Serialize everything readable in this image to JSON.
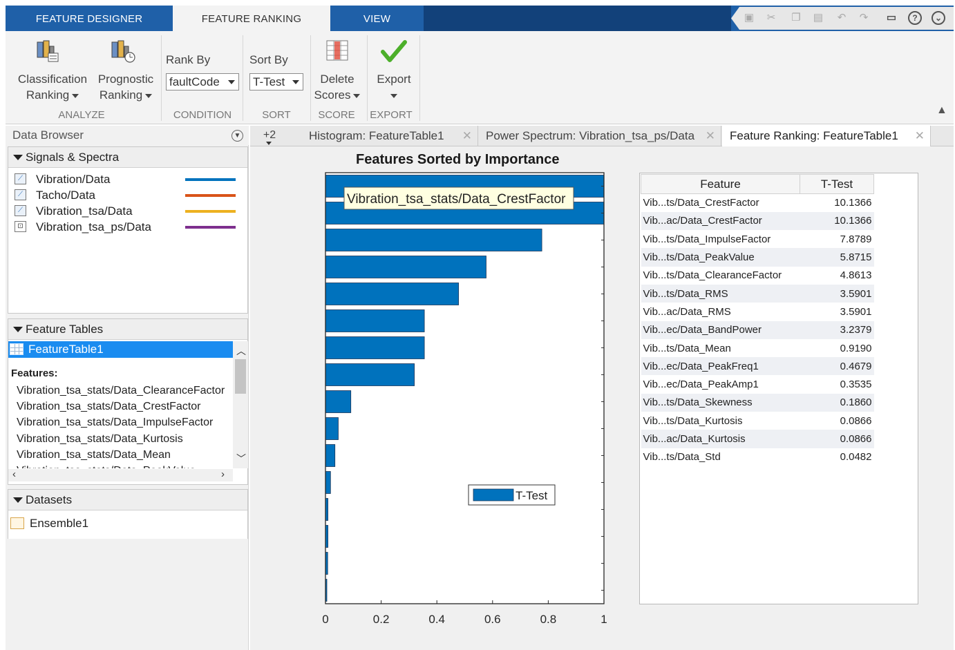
{
  "toolstrip": {
    "tabs": [
      "FEATURE DESIGNER",
      "FEATURE RANKING",
      "VIEW"
    ]
  },
  "ribbon": {
    "classification": [
      "Classification",
      "Ranking"
    ],
    "prognostic": [
      "Prognostic",
      "Ranking"
    ],
    "analyze_label": "ANALYZE",
    "rank_by_label": "Rank By",
    "rank_by_value": "faultCode",
    "condition_label": "CONDITION",
    "sort_by_label": "Sort By",
    "sort_by_value": "T-Test",
    "sort_label": "SORT",
    "delete": [
      "Delete",
      "Scores"
    ],
    "score_label": "SCORE",
    "export_label": "Export",
    "export_section": "EXPORT"
  },
  "browser": {
    "title": "Data Browser",
    "signals_header": "Signals & Spectra",
    "signals": [
      {
        "name": "Vibration/Data",
        "color": "#0072bd"
      },
      {
        "name": "Tacho/Data",
        "color": "#d95319"
      },
      {
        "name": "Vibration_tsa/Data",
        "color": "#edb120"
      },
      {
        "name": "Vibration_tsa_ps/Data",
        "color": "#7e2f8e"
      }
    ],
    "feature_tables_header": "Feature Tables",
    "selected_table": "FeatureTable1",
    "features_label": "Features:",
    "features": [
      "Vibration_tsa_stats/Data_ClearanceFactor",
      "Vibration_tsa_stats/Data_CrestFactor",
      "Vibration_tsa_stats/Data_ImpulseFactor",
      "Vibration_tsa_stats/Data_Kurtosis",
      "Vibration_tsa_stats/Data_Mean",
      "Vibration_tsa_stats/Data_PeakValue"
    ],
    "datasets_header": "Datasets",
    "dataset": "Ensemble1"
  },
  "doc_tabs": {
    "more": "+2",
    "tabs": [
      "Histogram: FeatureTable1",
      "Power Spectrum: Vibration_tsa_ps/Data",
      "Feature Ranking: FeatureTable1"
    ]
  },
  "chart_title": "Features Sorted by Importance",
  "chart_data": {
    "type": "bar",
    "orientation": "horizontal",
    "title": "Features Sorted by Importance",
    "series": [
      {
        "name": "T-Test",
        "color": "#0072bd"
      }
    ],
    "values": [
      1.0,
      1.0,
      0.777,
      0.577,
      0.478,
      0.355,
      0.355,
      0.319,
      0.091,
      0.046,
      0.034,
      0.018,
      0.009,
      0.009,
      0.008,
      0.005
    ],
    "xlim": [
      0,
      1
    ],
    "xticks": [
      "0",
      "0.2",
      "0.4",
      "0.6",
      "0.8",
      "1"
    ],
    "tooltip": "Vibration_tsa_stats/Data_CrestFactor",
    "legend": "T-Test",
    "legend_position": "right"
  },
  "table": {
    "headers": [
      "Feature",
      "T-Test"
    ],
    "rows": [
      [
        "Vib...ts/Data_CrestFactor",
        "10.1366"
      ],
      [
        "Vib...ac/Data_CrestFactor",
        "10.1366"
      ],
      [
        "Vib...ts/Data_ImpulseFactor",
        "7.8789"
      ],
      [
        "Vib...ts/Data_PeakValue",
        "5.8715"
      ],
      [
        "Vib...ts/Data_ClearanceFactor",
        "4.8613"
      ],
      [
        "Vib...ts/Data_RMS",
        "3.5901"
      ],
      [
        "Vib...ac/Data_RMS",
        "3.5901"
      ],
      [
        "Vib...ec/Data_BandPower",
        "3.2379"
      ],
      [
        "Vib...ts/Data_Mean",
        "0.9190"
      ],
      [
        "Vib...ec/Data_PeakFreq1",
        "0.4679"
      ],
      [
        "Vib...ec/Data_PeakAmp1",
        "0.3535"
      ],
      [
        "Vib...ts/Data_Skewness",
        "0.1860"
      ],
      [
        "Vib...ts/Data_Kurtosis",
        "0.0866"
      ],
      [
        "Vib...ac/Data_Kurtosis",
        "0.0866"
      ],
      [
        "Vib...ts/Data_Std",
        "0.0482"
      ]
    ]
  }
}
